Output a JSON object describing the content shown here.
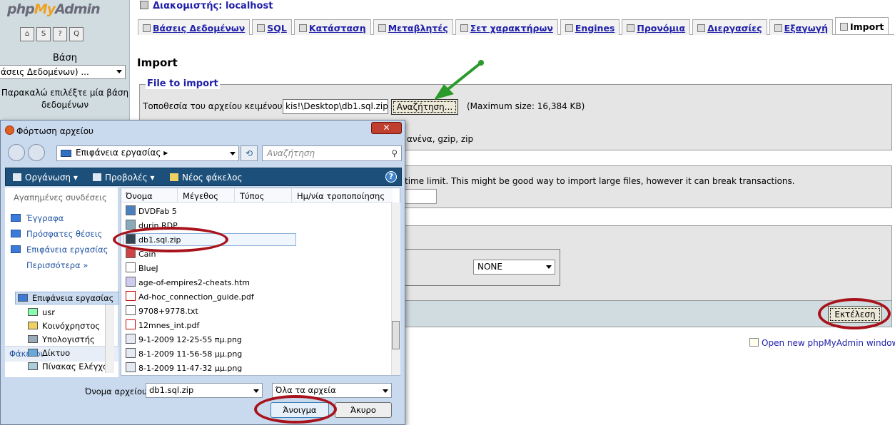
{
  "left": {
    "logo_php": "php",
    "logo_my": "My",
    "logo_admin": "Admin",
    "quick_icons": [
      "home-icon",
      "sql-icon",
      "docs-icon",
      "query-icon"
    ],
    "db_label": "Βάση",
    "db_select": "άσεις Δεδομένων) ...",
    "db_hint": "Παρακαλώ επιλέξτε μία βάση δεδομένων"
  },
  "header": {
    "server": "Διακομιστής: localhost"
  },
  "tabs": [
    {
      "label": "Βάσεις Δεδομένων",
      "icon": "database-icon"
    },
    {
      "label": "SQL",
      "icon": "sql-icon"
    },
    {
      "label": "Κατάσταση",
      "icon": "status-icon"
    },
    {
      "label": "Μεταβλητές",
      "icon": "variables-icon"
    },
    {
      "label": "Σετ χαρακτήρων",
      "icon": "charset-icon"
    },
    {
      "label": "Engines",
      "icon": "engines-icon"
    },
    {
      "label": "Προνόμια",
      "icon": "privileges-icon"
    },
    {
      "label": "Διεργασίες",
      "icon": "processes-icon"
    },
    {
      "label": "Εξαγωγή",
      "icon": "export-icon"
    },
    {
      "label": "Import",
      "icon": "import-icon",
      "active": true
    }
  ],
  "import": {
    "title": "Import",
    "file_legend": "File to import",
    "file_location_label": "Τοποθεσία του αρχείου κειμένου",
    "file_value": "kis!\\Desktop\\db1.sql.zip",
    "browse": "Αναζήτηση...",
    "max_size": "(Maximum size: 16,384 KB)",
    "compression_tail": "ανένα, gzip, zip",
    "time_limit_text": "time limit. This might be good way to import large files, however it can break transactions.",
    "format_value": "NONE",
    "go": "Εκτέλεση",
    "new_window": "Open new phpMyAdmin window"
  },
  "dialog": {
    "title": "Φόρτωση αρχείου",
    "address": "Επιφάνεια εργασίας",
    "search_placeholder": "Αναζήτηση",
    "toolbar": {
      "organize": "Οργάνωση",
      "views": "Προβολές",
      "new_folder": "Νέος φάκελος"
    },
    "favorites_header": "Αγαπημένες συνδέσεις",
    "favorites": [
      "Έγγραφα",
      "Πρόσφατες θέσεις",
      "Επιφάνεια εργασίας",
      "Περισσότερα »"
    ],
    "folders_header": "Φάκελοι",
    "folders": [
      "Επιφάνεια εργασίας",
      "usr",
      "Κοινόχρηστος",
      "Υπολογιστής",
      "Δίκτυο",
      "Πίνακας Ελέγχου"
    ],
    "columns": [
      "Όνομα",
      "Μέγεθος",
      "Τύπος",
      "Ημ/νία τροποποίησης"
    ],
    "files": [
      {
        "name": "DVDFab 5",
        "type": "shortcut"
      },
      {
        "name": "durin.RDP",
        "type": "rdp"
      },
      {
        "name": "db1.sql.zip",
        "type": "zip",
        "selected": true
      },
      {
        "name": "Cain",
        "type": "shortcut"
      },
      {
        "name": "BlueJ",
        "type": "shortcut"
      },
      {
        "name": "age-of-empires2-cheats.htm",
        "type": "htm"
      },
      {
        "name": "Ad-hoc_connection_guide.pdf",
        "type": "pdf"
      },
      {
        "name": "9708+9778.txt",
        "type": "txt"
      },
      {
        "name": "12mnes_int.pdf",
        "type": "pdf"
      },
      {
        "name": "9-1-2009 12-25-55 πμ.png",
        "type": "png"
      },
      {
        "name": "8-1-2009 11-56-58 μμ.png",
        "type": "png"
      },
      {
        "name": "8-1-2009 11-47-32 μμ.png",
        "type": "png"
      }
    ],
    "filename_label": "Όνομα αρχείου:",
    "filename_value": "db1.sql.zip",
    "filetype_value": "Όλα τα αρχεία",
    "open": "Άνοιγμα",
    "cancel": "Άκυρο"
  },
  "colors": {
    "link": "#2020aa",
    "annotation": "#a8131b",
    "arrow": "#2a9a2a",
    "dialog_toolbar": "#1c4f7a"
  }
}
